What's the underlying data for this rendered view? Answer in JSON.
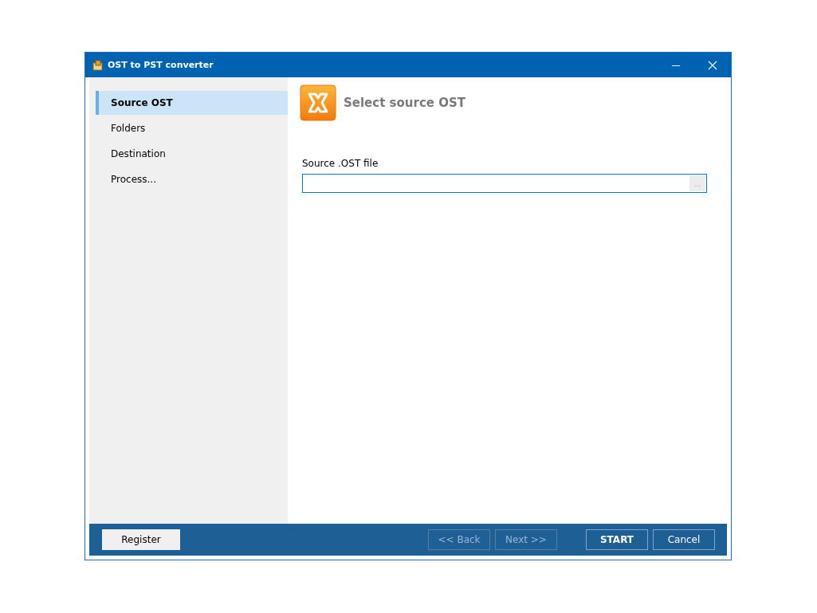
{
  "window": {
    "title": "OST to PST converter"
  },
  "sidebar": {
    "items": [
      {
        "label": "Source OST",
        "selected": true
      },
      {
        "label": "Folders",
        "selected": false
      },
      {
        "label": "Destination",
        "selected": false
      },
      {
        "label": "Process...",
        "selected": false
      }
    ]
  },
  "page": {
    "heading": "Select source OST",
    "field": {
      "label": "Source .OST file",
      "browse": "..."
    }
  },
  "footer": {
    "buttons": [
      {
        "label": "Register",
        "kind": "light",
        "disabled": false
      },
      {
        "label": "<< Back",
        "kind": "dark",
        "disabled": true
      },
      {
        "label": "Next >>",
        "kind": "dark",
        "disabled": true
      },
      {
        "label": "START",
        "kind": "primary",
        "disabled": false
      },
      {
        "label": "Cancel",
        "kind": "dark",
        "disabled": false
      }
    ]
  }
}
